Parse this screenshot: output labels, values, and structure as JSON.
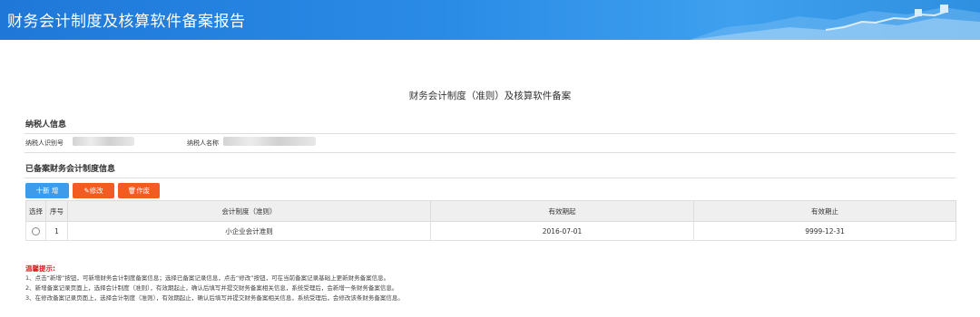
{
  "header": {
    "title": "财务会计制度及核算软件备案报告"
  },
  "page": {
    "title": "财务会计制度（准则）及核算软件备案"
  },
  "taxpayer": {
    "section_title": "纳税人信息",
    "id_label": "纳税人识别号",
    "name_label": "纳税人名称"
  },
  "records": {
    "section_title": "已备案财务会计制度信息",
    "buttons": {
      "add": "十新 增",
      "edit": "修改",
      "void": "作废"
    },
    "columns": [
      "选择",
      "序号",
      "会计制度（准则）",
      "有效期起",
      "有效期止"
    ],
    "rows": [
      {
        "index": "1",
        "standard": "小企业会计准则",
        "start": "2016-07-01",
        "end": "9999-12-31"
      }
    ]
  },
  "tips": {
    "title": "温馨提示:",
    "lines": [
      "1、点击“新增”按钮，可新增财务会计制度备案信息；选择已备案记录信息，点击“修改”按钮，可在当前备案记录基础上更新财务备案信息。",
      "2、新增备案记录页面上，选择会计制度（准则），有效期起止，确认后填写并提交财务备案相关信息，系统受理后，会新增一条财务备案信息。",
      "3、在修改备案记录页面上，选择会计制度（准则），有效期起止，确认后填写并提交财务备案相关信息，系统受理后，会修改该条财务备案信息。"
    ]
  },
  "colors": {
    "banner": "#2a8be6",
    "primary_button": "#3d9be9",
    "danger_button": "#f25b22",
    "tips_title": "#e02020"
  }
}
